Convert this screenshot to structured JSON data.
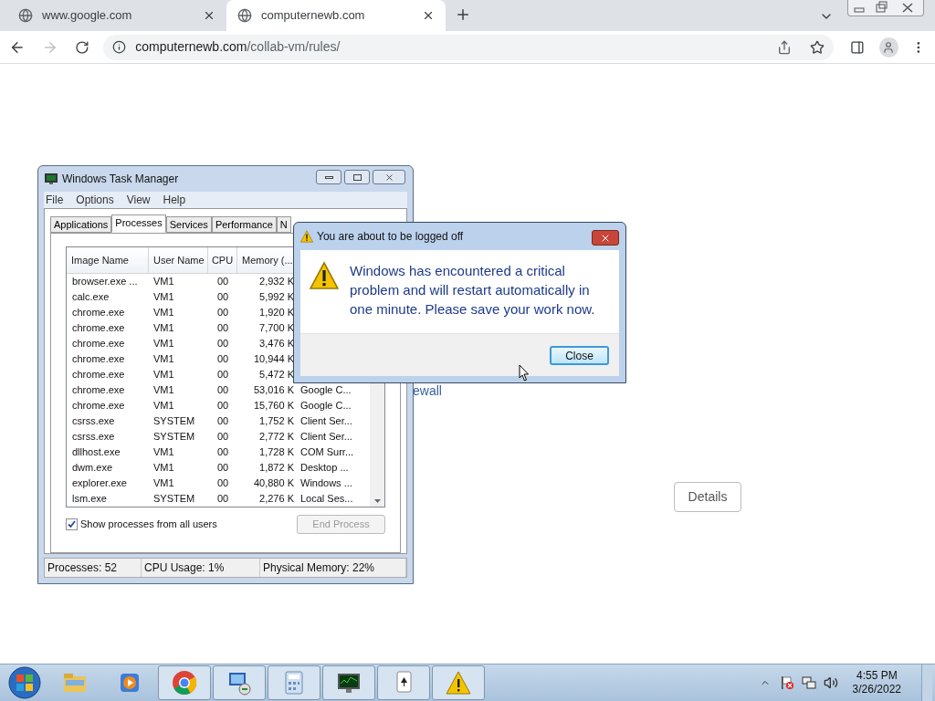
{
  "browser": {
    "tabs": [
      {
        "title": "www.google.com",
        "selected": false
      },
      {
        "title": "computernewb.com",
        "selected": true
      }
    ],
    "address": {
      "host": "computernewb.com",
      "path": "/collab-vm/rules/"
    }
  },
  "page": {
    "partial_text": "ewall",
    "details_button": "Details"
  },
  "task_manager": {
    "title": "Windows Task Manager",
    "menu": [
      "File",
      "Options",
      "View",
      "Help"
    ],
    "tabs": [
      {
        "label": "Applications",
        "selected": false
      },
      {
        "label": "Processes",
        "selected": true
      },
      {
        "label": "Services",
        "selected": false
      },
      {
        "label": "Performance",
        "selected": false
      },
      {
        "label": "N",
        "selected": false
      }
    ],
    "columns": [
      "Image Name",
      "User Name",
      "CPU",
      "Memory (..."
    ],
    "rows": [
      [
        "browser.exe ...",
        "VM1",
        "00",
        "2,932 K"
      ],
      [
        "calc.exe",
        "VM1",
        "00",
        "5,992 K"
      ],
      [
        "chrome.exe",
        "VM1",
        "00",
        "1,920 K"
      ],
      [
        "chrome.exe",
        "VM1",
        "00",
        "7,700 K"
      ],
      [
        "chrome.exe",
        "VM1",
        "00",
        "3,476 K"
      ],
      [
        "chrome.exe",
        "VM1",
        "00",
        "10,944 K"
      ],
      [
        "chrome.exe",
        "VM1",
        "00",
        "5,472 K"
      ],
      [
        "chrome.exe",
        "VM1",
        "00",
        "53,016 K",
        "Google C..."
      ],
      [
        "chrome.exe",
        "VM1",
        "00",
        "15,760 K",
        "Google C..."
      ],
      [
        "csrss.exe",
        "SYSTEM",
        "00",
        "1,752 K",
        "Client Ser..."
      ],
      [
        "csrss.exe",
        "SYSTEM",
        "00",
        "2,772 K",
        "Client Ser..."
      ],
      [
        "dllhost.exe",
        "VM1",
        "00",
        "1,728 K",
        "COM Surr..."
      ],
      [
        "dwm.exe",
        "VM1",
        "00",
        "1,872 K",
        "Desktop ..."
      ],
      [
        "explorer.exe",
        "VM1",
        "00",
        "40,880 K",
        "Windows ..."
      ],
      [
        "lsm.exe",
        "SYSTEM",
        "00",
        "2,276 K",
        "Local Ses..."
      ]
    ],
    "show_all": {
      "label": "Show processes from all users",
      "checked": true
    },
    "end_process": {
      "label": "End Process",
      "disabled": true
    },
    "status": [
      "Processes: 52",
      "CPU Usage: 1%",
      "Physical Memory: 22%"
    ]
  },
  "dialog": {
    "title": "You are about to be logged off",
    "message": "Windows has encountered a critical problem and will restart automatically in one minute. Please save your work now.",
    "button": "Close"
  },
  "taskbar": {
    "items": [
      {
        "kind": "folder",
        "running": false
      },
      {
        "kind": "media",
        "running": false
      },
      {
        "kind": "chrome",
        "running": true
      },
      {
        "kind": "remote",
        "running": true
      },
      {
        "kind": "calculator",
        "running": true
      },
      {
        "kind": "monitor",
        "running": true
      },
      {
        "kind": "cards",
        "running": true
      },
      {
        "kind": "warning",
        "running": true
      }
    ],
    "time": "4:55 PM",
    "date": "3/26/2022"
  }
}
